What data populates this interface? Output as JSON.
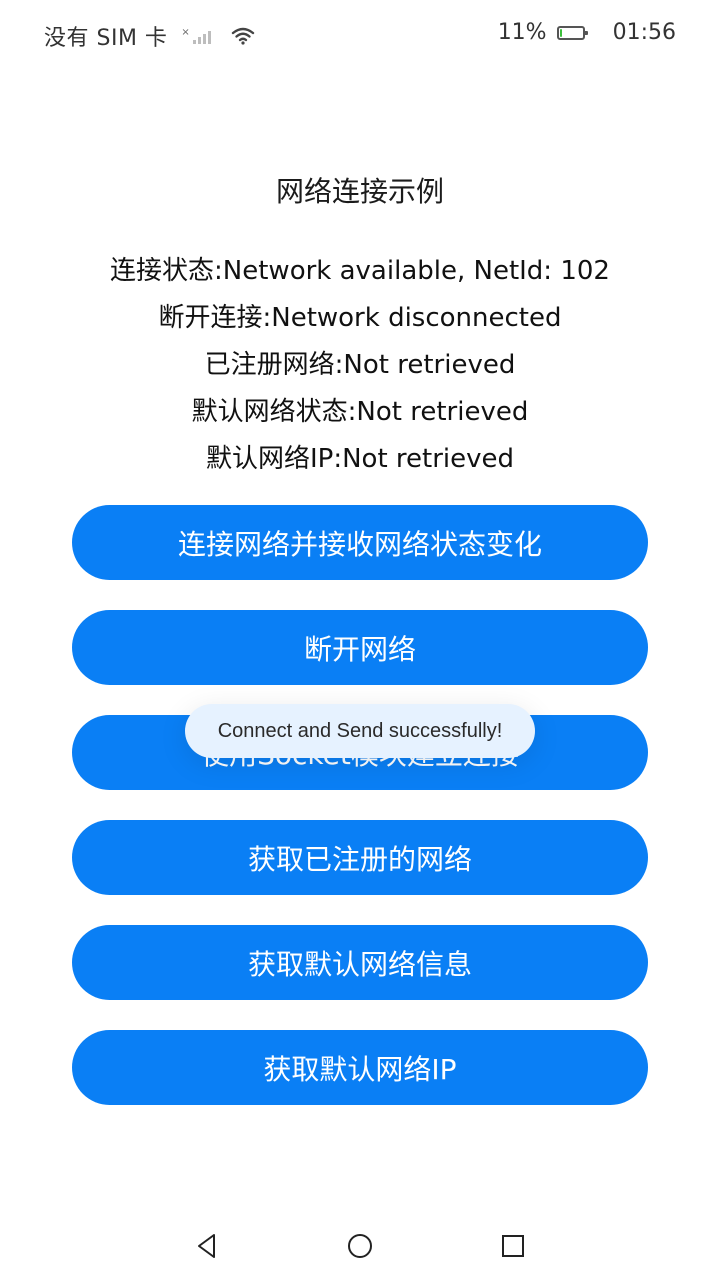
{
  "status_bar": {
    "carrier": "没有 SIM 卡",
    "signal_icon": "signal-icon",
    "wifi_icon": "wifi-icon",
    "battery_percent": "11%",
    "battery_level": 0.11,
    "battery_color": "#3cbf3c",
    "time": "01:56"
  },
  "page": {
    "title": "网络连接示例",
    "info_lines": [
      "连接状态:Network available, NetId: 102",
      "断开连接:Network disconnected",
      "已注册网络:Not retrieved",
      "默认网络状态:Not retrieved",
      "默认网络IP:Not retrieved"
    ],
    "buttons": [
      "连接网络并接收网络状态变化",
      "断开网络",
      "使用Socket模块建立连接",
      "获取已注册的网络",
      "获取默认网络信息",
      "获取默认网络IP"
    ],
    "button_color": "#0a7ff5"
  },
  "toast": {
    "message": "Connect and Send successfully!"
  },
  "nav_bar": {
    "back_icon": "back-triangle-icon",
    "home_icon": "home-circle-icon",
    "recents_icon": "recents-square-icon"
  }
}
